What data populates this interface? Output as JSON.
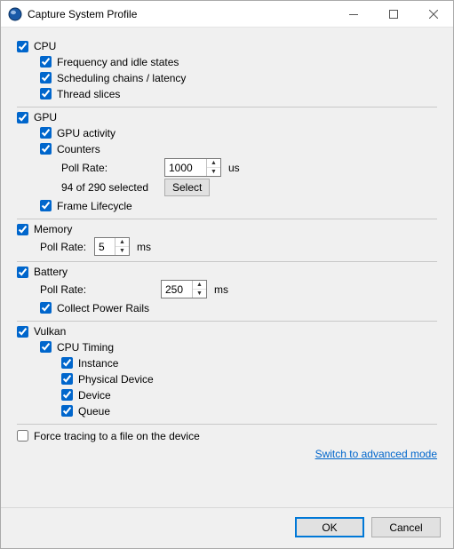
{
  "window": {
    "title": "Capture System Profile"
  },
  "cpu": {
    "label": "CPU",
    "freq_idle": "Frequency and idle states",
    "sched": "Scheduling chains / latency",
    "slices": "Thread slices"
  },
  "gpu": {
    "label": "GPU",
    "activity": "GPU activity",
    "counters": "Counters",
    "poll_label": "Poll Rate:",
    "poll_value": "1000",
    "poll_unit": "us",
    "selected_text": "94 of 290 selected",
    "select_btn": "Select",
    "frame": "Frame Lifecycle"
  },
  "memory": {
    "label": "Memory",
    "poll_label": "Poll Rate:",
    "poll_value": "5",
    "poll_unit": "ms"
  },
  "battery": {
    "label": "Battery",
    "poll_label": "Poll Rate:",
    "poll_value": "250",
    "poll_unit": "ms",
    "rails": "Collect Power Rails"
  },
  "vulkan": {
    "label": "Vulkan",
    "cpu_timing": "CPU Timing",
    "instance": "Instance",
    "phys_device": "Physical Device",
    "device": "Device",
    "queue": "Queue"
  },
  "force_trace": "Force tracing to a file on the device",
  "advanced_link": "Switch to advanced mode",
  "buttons": {
    "ok": "OK",
    "cancel": "Cancel"
  }
}
